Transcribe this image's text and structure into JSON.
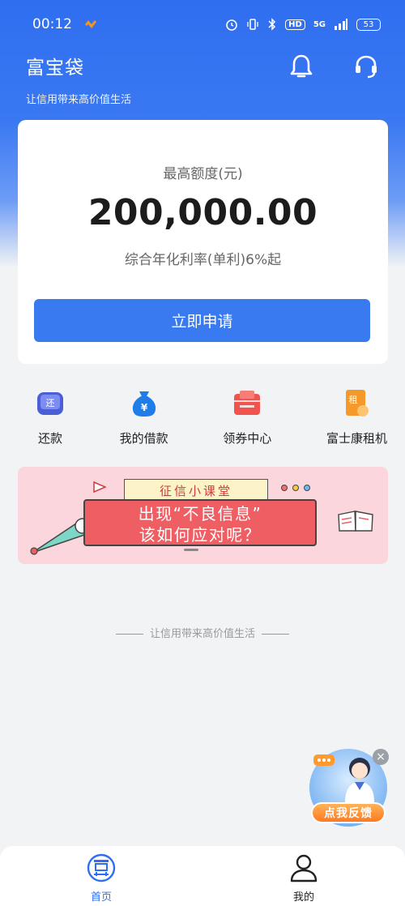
{
  "status_bar": {
    "time": "00:12",
    "network": "5G",
    "hd_badge": "HD",
    "battery": "53"
  },
  "header": {
    "title": "富宝袋",
    "subtitle": "让信用带来高价值生活",
    "icons": [
      "bell-icon",
      "headset-icon"
    ]
  },
  "credit_card": {
    "label": "最高额度(元)",
    "amount": "200,000.00",
    "rate_text": "综合年化利率(单利)6%起",
    "apply_label": "立即申请"
  },
  "quick_actions": [
    {
      "label": "还款",
      "icon": "repay-icon",
      "icon_text": "还",
      "color": "#4a5fd6"
    },
    {
      "label": "我的借款",
      "icon": "money-bag-icon",
      "icon_text": "¥",
      "color": "#1e7de8"
    },
    {
      "label": "领券中心",
      "icon": "coupon-icon",
      "icon_text": "",
      "color": "#f0544f"
    },
    {
      "label": "富士康租机",
      "icon": "rent-phone-icon",
      "icon_text": "租",
      "color": "#f59a2a"
    }
  ],
  "banner": {
    "top_text": "征信小课堂",
    "main_line1": "出现“不良信息”",
    "main_line2": "该如何应对呢？"
  },
  "footer_slogan": "让信用带来高价值生活",
  "feedback": {
    "label": "点我反馈",
    "close": "×"
  },
  "tabbar": {
    "items": [
      {
        "label": "首页",
        "icon": "home-icon",
        "active": true
      },
      {
        "label": "我的",
        "icon": "profile-icon",
        "active": false
      }
    ]
  },
  "colors": {
    "primary": "#3a7af0",
    "active_tab": "#2f6ef0"
  }
}
